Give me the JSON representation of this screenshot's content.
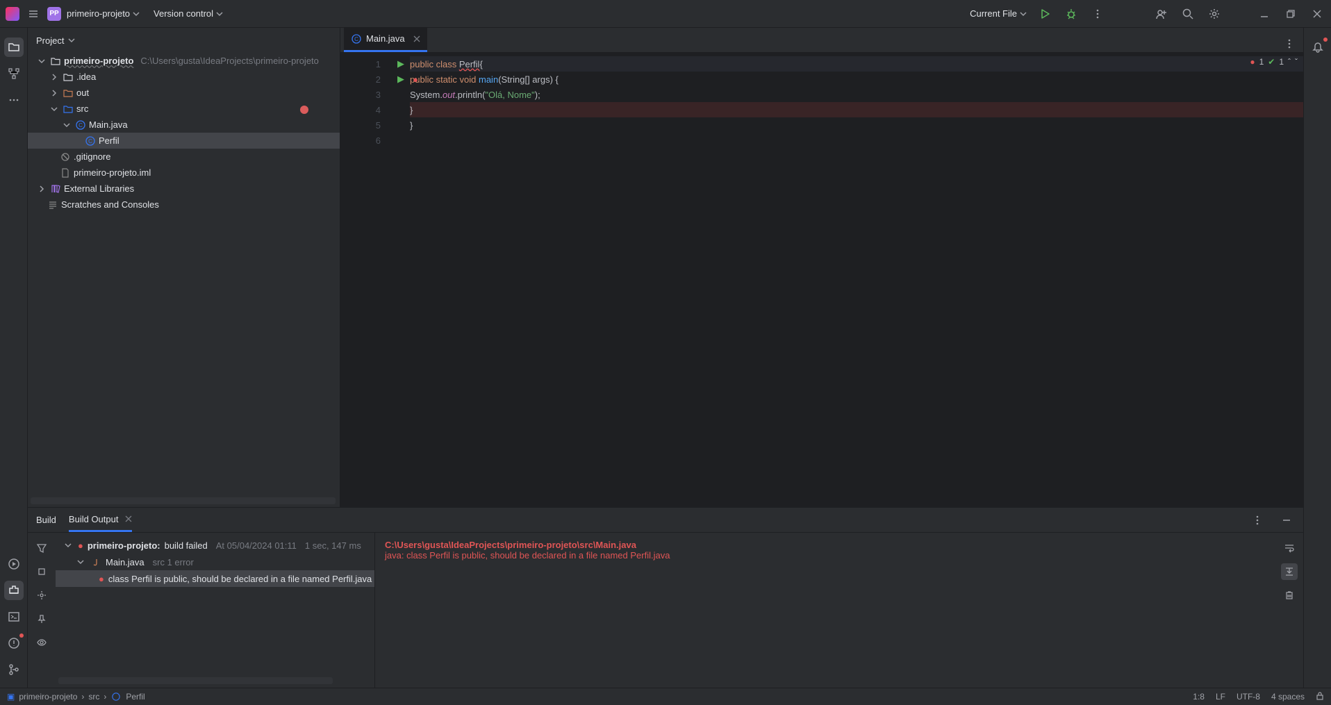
{
  "titlebar": {
    "project_badge": "PP",
    "project_name": "primeiro-projeto",
    "version_control": "Version control",
    "run_config": "Current File"
  },
  "project_panel": {
    "title": "Project",
    "tree": {
      "root": {
        "name": "primeiro-projeto",
        "path": "C:\\Users\\gusta\\IdeaProjects\\primeiro-projeto"
      },
      "idea": ".idea",
      "out": "out",
      "src": "src",
      "main_java": "Main.java",
      "perfil": "Perfil",
      "gitignore": ".gitignore",
      "iml": "primeiro-projeto.iml",
      "ext_libs": "External Libraries",
      "scratches": "Scratches and Consoles"
    }
  },
  "editor": {
    "tab_name": "Main.java",
    "errors_count": "1",
    "warnings_count": "1",
    "lines": {
      "l1": {
        "k1": "public ",
        "k2": "class ",
        "cls": "Perfil",
        "b": "{"
      },
      "l2": {
        "k1": "public static void ",
        "m": "main",
        "args": "(String[] args) {"
      },
      "l3": {
        "p1": "System.",
        "f": "out",
        "p2": ".println(",
        "s": "\"Olá, Nome\"",
        "p3": ");"
      },
      "l4": "}",
      "l5": "}"
    },
    "gutter": [
      "1",
      "2",
      "3",
      "4",
      "5",
      "6"
    ]
  },
  "build": {
    "label": "Build",
    "output_tab": "Build Output",
    "row1": {
      "proj": "primeiro-projeto:",
      "status": "build failed",
      "ts": "At 05/04/2024 01:11",
      "dur": "1 sec, 147 ms"
    },
    "row2": {
      "file": "Main.java",
      "loc": "src 1 error"
    },
    "row3": "class Perfil is public, should be declared in a file named Perfil.java",
    "output_line1": "C:\\Users\\gusta\\IdeaProjects\\primeiro-projeto\\src\\Main.java",
    "output_line2": "java: class Perfil is public, should be declared in a file named Perfil.java"
  },
  "breadcrumb": {
    "b1": "primeiro-projeto",
    "b2": "src",
    "b3": "Perfil"
  },
  "statusbar": {
    "pos": "1:8",
    "le": "LF",
    "enc": "UTF-8",
    "indent": "4 spaces"
  }
}
